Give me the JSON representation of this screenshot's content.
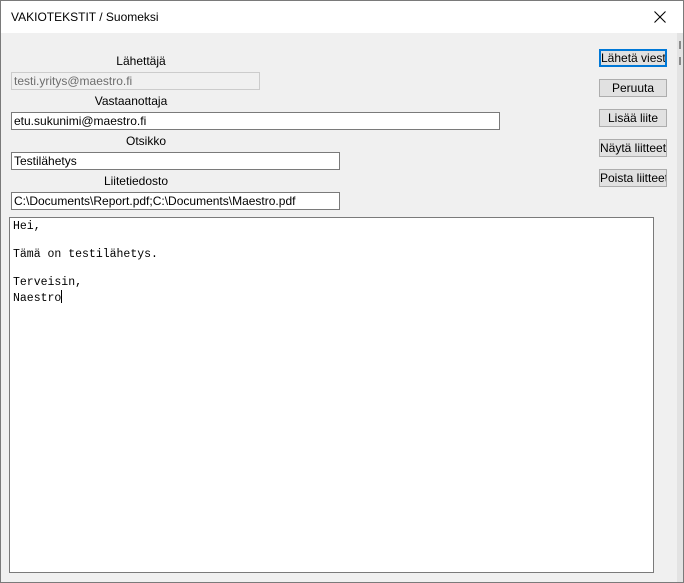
{
  "window": {
    "title": "VAKIOTEKSTIT / Suomeksi"
  },
  "form": {
    "sender_label": "Lähettäjä",
    "sender_value": "testi.yritys@maestro.fi",
    "recipient_label": "Vastaanottaja",
    "recipient_value": "etu.sukunimi@maestro.fi",
    "subject_label": "Otsikko",
    "subject_value": "Testilähetys",
    "attachment_label": "Liitetiedosto",
    "attachment_value": "C:\\Documents\\Report.pdf;C:\\Documents\\Maestro.pdf"
  },
  "buttons": {
    "send": "Lähetä viesti",
    "cancel": "Peruuta",
    "add_attachment": "Lisää liite",
    "show_attachments": "Näytä liitteet",
    "remove_attachments": "Poista liitteet"
  },
  "message": {
    "lines": [
      "Hei,",
      "",
      "Tämä on testilähetys.",
      "",
      "Terveisin,",
      "Naestro"
    ]
  },
  "icons": {
    "close": "close-icon"
  },
  "colors": {
    "default_button_border": "#0078d7",
    "window_background": "#f0f0f0"
  }
}
